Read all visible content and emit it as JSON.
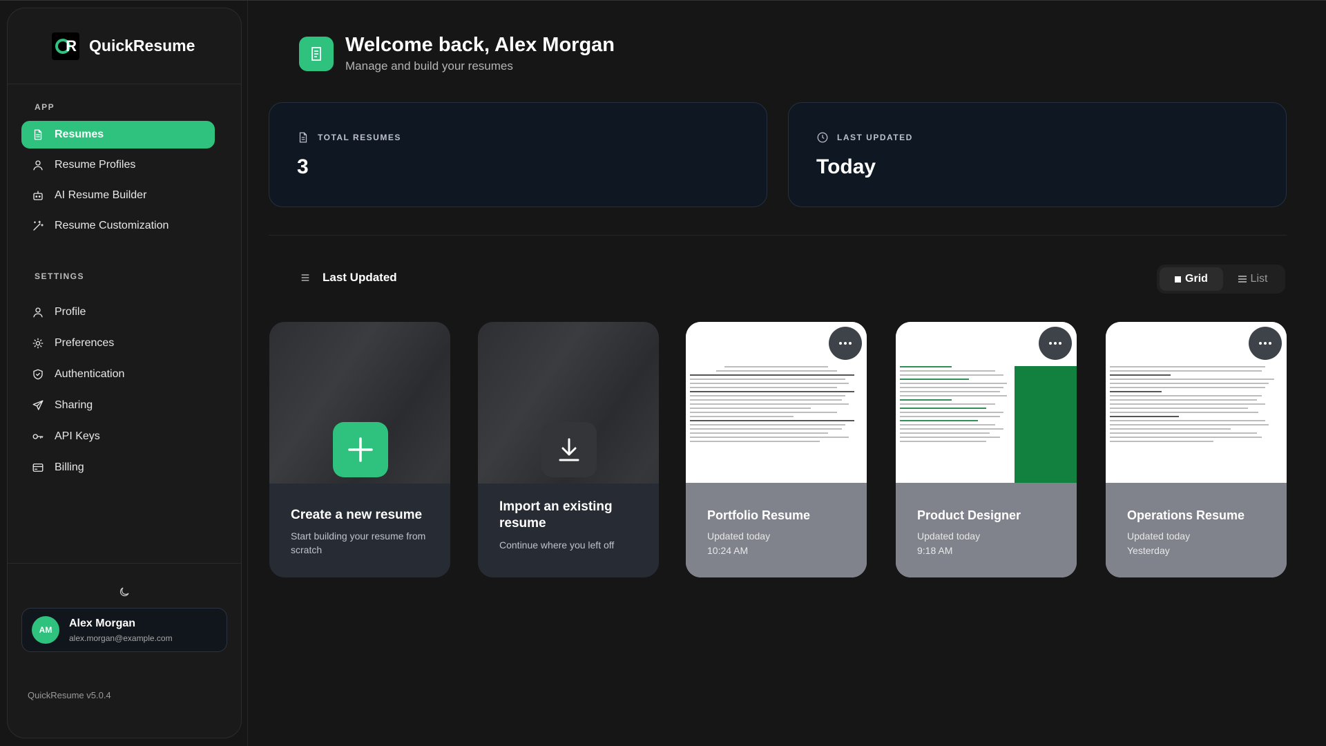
{
  "app": {
    "name": "QuickResume",
    "version": "QuickResume v5.0.4"
  },
  "sidebar": {
    "app_label": "APP",
    "app_items": [
      {
        "label": "Resumes",
        "icon": "document-icon",
        "active": true
      },
      {
        "label": "Resume Profiles",
        "icon": "user-icon"
      },
      {
        "label": "AI Resume Builder",
        "icon": "robot-icon"
      },
      {
        "label": "Resume Customization",
        "icon": "magic-wand-icon"
      }
    ],
    "settings_label": "SETTINGS",
    "settings_items": [
      {
        "label": "Profile",
        "icon": "user-icon"
      },
      {
        "label": "Preferences",
        "icon": "sun-icon"
      },
      {
        "label": "Authentication",
        "icon": "shield-icon"
      },
      {
        "label": "Sharing",
        "icon": "send-icon"
      },
      {
        "label": "API Keys",
        "icon": "key-icon"
      },
      {
        "label": "Billing",
        "icon": "credit-card-icon"
      }
    ]
  },
  "user": {
    "initials": "AM",
    "name": "Alex Morgan",
    "email": "alex.morgan@example.com"
  },
  "header": {
    "title": "Welcome back, Alex Morgan",
    "subtitle": "Manage and build your resumes"
  },
  "stats": {
    "total_label": "TOTAL RESUMES",
    "total_value": "3",
    "updated_label": "LAST UPDATED",
    "updated_value": "Today"
  },
  "sort": {
    "label": "Last Updated"
  },
  "view_toggle": {
    "grid": "Grid",
    "list": "List",
    "selected": "Grid"
  },
  "cards": {
    "create": {
      "title": "Create a new resume",
      "subtitle": "Start building your resume from scratch"
    },
    "import": {
      "title": "Import an existing resume",
      "subtitle": "Continue where you left off"
    },
    "resumes": [
      {
        "title": "Portfolio Resume",
        "updated": "Updated today",
        "time": "10:24 AM"
      },
      {
        "title": "Product Designer",
        "updated": "Updated today",
        "time": "9:18 AM"
      },
      {
        "title": "Operations Resume",
        "updated": "Updated today",
        "time": "Yesterday"
      }
    ]
  },
  "colors": {
    "accent": "#2ec27e",
    "background": "#161616",
    "sidebar": "#1a1a1a",
    "stat_card": "#0f1722"
  }
}
